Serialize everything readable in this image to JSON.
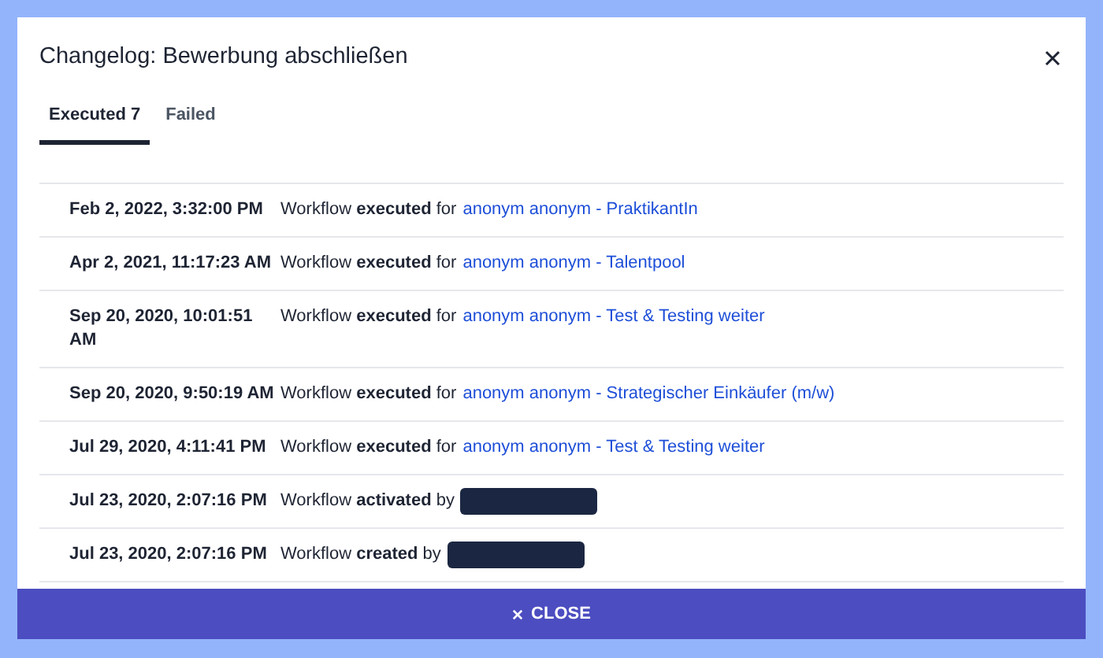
{
  "dialog": {
    "title": "Changelog: Bewerbung abschließen"
  },
  "tabs": [
    {
      "label": "Executed 7",
      "selected": true
    },
    {
      "label": "Failed",
      "selected": false
    }
  ],
  "entries": [
    {
      "date": "Feb 2, 2022, 3:32:00 PM",
      "message": "Workflow **executed** for",
      "target": {
        "kind": "link",
        "text": "anonym anonym - PraktikantIn"
      }
    },
    {
      "date": "Apr 2, 2021, 11:17:23 AM",
      "message": "Workflow **executed** for",
      "target": {
        "kind": "link",
        "text": "anonym anonym - Talentpool"
      }
    },
    {
      "date": "Sep 20, 2020, 10:01:51 AM",
      "message": "Workflow **executed** for",
      "target": {
        "kind": "link",
        "text": "anonym anonym - Test & Testing weiter"
      }
    },
    {
      "date": "Sep 20, 2020, 9:50:19 AM",
      "message": "Workflow **executed** for",
      "target": {
        "kind": "link",
        "text": "anonym anonym - Strategischer Einkäufer (m/w)"
      }
    },
    {
      "date": "Jul 29, 2020, 4:11:41 PM",
      "message": "Workflow **executed** for",
      "target": {
        "kind": "link",
        "text": "anonym anonym - Test & Testing weiter"
      }
    },
    {
      "date": "Jul 23, 2020, 2:07:16 PM",
      "message": "Workflow **activated** by",
      "target": {
        "kind": "redacted"
      }
    },
    {
      "date": "Jul 23, 2020, 2:07:16 PM",
      "message": "Workflow **created** by",
      "target": {
        "kind": "redacted"
      }
    }
  ],
  "close_button": {
    "label": "CLOSE"
  }
}
